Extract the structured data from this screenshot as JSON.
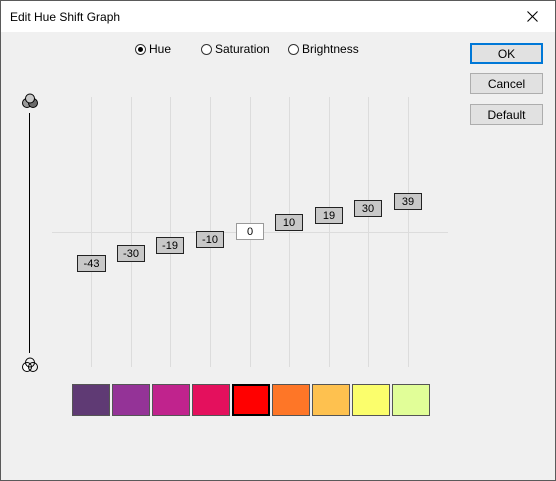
{
  "window": {
    "title": "Edit Hue Shift Graph"
  },
  "modes": [
    {
      "label": "Hue",
      "checked": true
    },
    {
      "label": "Saturation",
      "checked": false
    },
    {
      "label": "Brightness",
      "checked": false
    }
  ],
  "buttons": {
    "ok": "OK",
    "cancel": "Cancel",
    "default": "Default"
  },
  "graph": {
    "values": [
      "-43",
      "-30",
      "-19",
      "-10",
      "0",
      "10",
      "19",
      "30",
      "39"
    ]
  },
  "swatches": [
    {
      "color": "#5f3a74"
    },
    {
      "color": "#943397"
    },
    {
      "color": "#c0238d"
    },
    {
      "color": "#e4105d"
    },
    {
      "color": "#ff0000",
      "selected": true
    },
    {
      "color": "#fe7627"
    },
    {
      "color": "#fec14f"
    },
    {
      "color": "#fbfe6c"
    },
    {
      "color": "#e1fe98"
    }
  ],
  "icons": {
    "close": "close-icon",
    "slider_top": "rgb-circles-icon",
    "slider_bottom": "rgb-outline-circles-icon"
  }
}
